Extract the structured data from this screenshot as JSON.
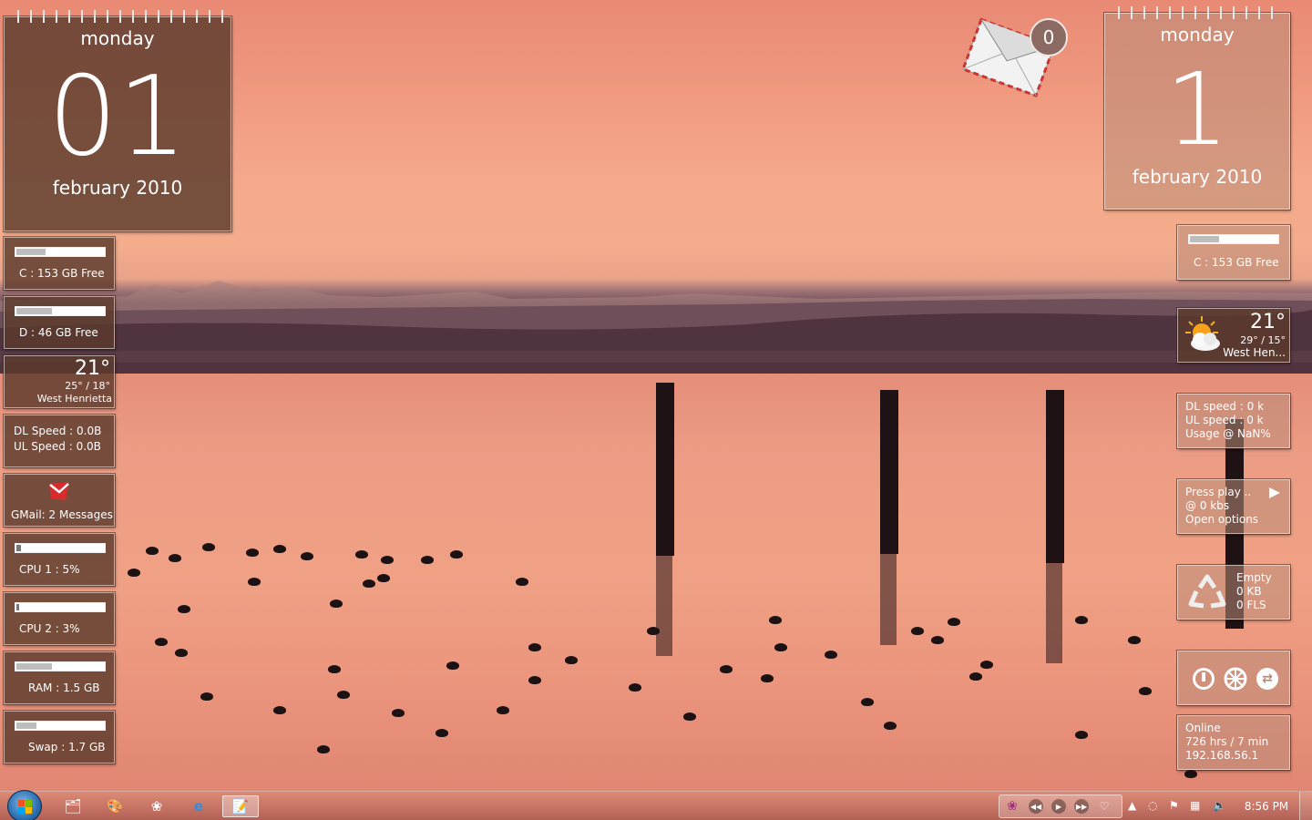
{
  "left_calendar": {
    "day": "monday",
    "date": "01",
    "month": "february 2010"
  },
  "right_calendar": {
    "day": "monday",
    "date": "1",
    "month": "february 2010"
  },
  "mail": {
    "count": "0"
  },
  "left_gadgets": {
    "drive_c": {
      "label": "C : 153 GB Free",
      "fill": 0.33
    },
    "drive_d": {
      "label": "D : 46 GB Free",
      "fill": 0.4
    },
    "weather": {
      "temp": "21°",
      "range": "25° / 18°",
      "city": "West Henrietta"
    },
    "network": {
      "dl": "DL Speed : 0.0B",
      "ul": "UL Speed : 0.0B"
    },
    "gmail": {
      "label": "GMail: 2 Messages"
    },
    "cpu1": {
      "label": "CPU 1 : 5%",
      "fill": 0.05
    },
    "cpu2": {
      "label": "CPU 2 : 3%",
      "fill": 0.03
    },
    "ram": {
      "label": "RAM : 1.5 GB",
      "fill": 0.4
    },
    "swap": {
      "label": "Swap : 1.7 GB",
      "fill": 0.22
    }
  },
  "right_gadgets": {
    "drive_c": {
      "label": "C : 153 GB Free",
      "fill": 0.33
    },
    "weather": {
      "temp": "21°",
      "range": "29° / 15°",
      "city": "West Hen..."
    },
    "network": {
      "dl": "DL speed : 0 k",
      "ul": "UL speed : 0 k",
      "usage": "Usage @ NaN%"
    },
    "player": {
      "status": "Press play ..",
      "rate": "@ 0 kbs",
      "options": "Open options"
    },
    "recycle": {
      "state": "Empty",
      "size": "0 KB",
      "files": "0 FLS"
    },
    "system": {
      "icons": [
        "power-icon",
        "settings-gear-icon",
        "switch-user-icon"
      ]
    },
    "connection": {
      "status": "Online",
      "uptime": "726 hrs / 7 min",
      "ip": "192.168.56.1"
    }
  },
  "taskbar": {
    "pinned": [
      "explorer-icon",
      "paint-icon",
      "flower-app-icon",
      "internet-explorer-icon",
      "notepad-icon"
    ],
    "clock": "8:56 PM"
  },
  "colors": {
    "tile": "#5c3a2c",
    "sky_top": "#e98a74",
    "water": "#f0a184"
  }
}
